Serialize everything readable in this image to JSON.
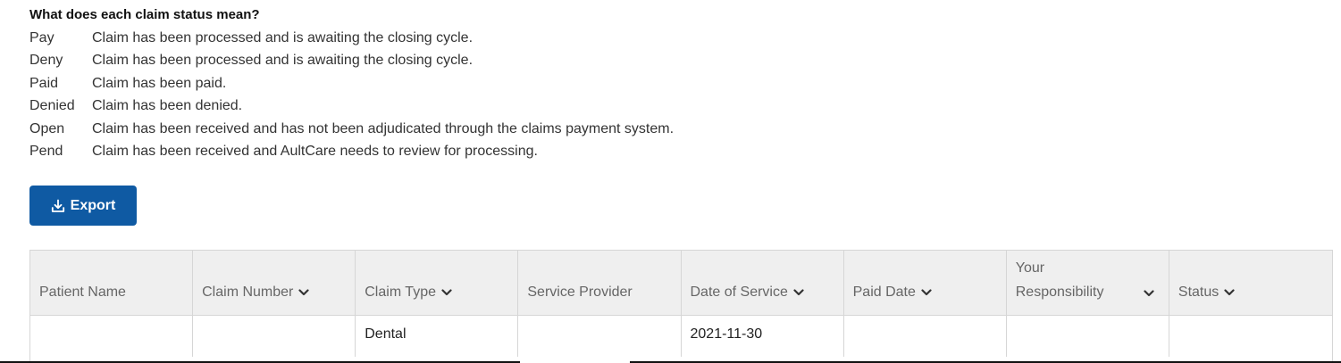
{
  "legend": {
    "title": "What does each claim status mean?",
    "items": [
      {
        "code": "Pay",
        "desc": "Claim has been processed and is awaiting the closing cycle."
      },
      {
        "code": "Deny",
        "desc": "Claim has been processed and is awaiting the closing cycle."
      },
      {
        "code": "Paid",
        "desc": "Claim has been paid."
      },
      {
        "code": "Denied",
        "desc": "Claim has been denied."
      },
      {
        "code": "Open",
        "desc": "Claim has been received and has not been adjudicated through the claims payment system."
      },
      {
        "code": "Pend",
        "desc": "Claim has been received and AultCare needs to review for processing."
      }
    ]
  },
  "export": {
    "label": "Export",
    "icon": "download-icon"
  },
  "table": {
    "columns": [
      {
        "label": "Patient Name",
        "sortable": false
      },
      {
        "label": "Claim Number",
        "sortable": true
      },
      {
        "label": "Claim Type",
        "sortable": true
      },
      {
        "label": "Service Provider",
        "sortable": false
      },
      {
        "label": "Date of Service",
        "sortable": true
      },
      {
        "label": "Paid Date",
        "sortable": true
      },
      {
        "label": "Your Responsibility",
        "sortable": true
      },
      {
        "label": "Status",
        "sortable": true
      }
    ],
    "rows": [
      [
        "",
        "",
        "Dental",
        "",
        "2021-11-30",
        "",
        "",
        ""
      ]
    ]
  },
  "colors": {
    "primary": "#0f5aa3",
    "header_bg": "#efefef",
    "border": "#d6d6d6"
  }
}
